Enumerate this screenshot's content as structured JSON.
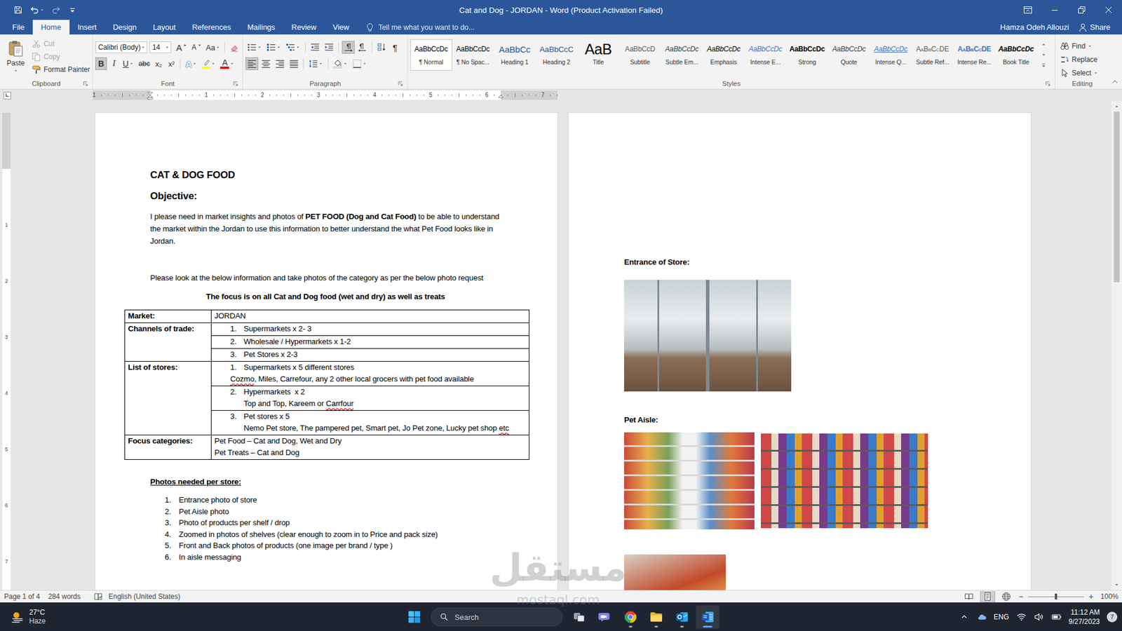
{
  "window": {
    "title": "Cat and Dog - JORDAN - Word (Product Activation Failed)"
  },
  "quick_access": {
    "undo_disabled": false,
    "redo_disabled": true
  },
  "tabs": [
    {
      "label": "File",
      "selected": false
    },
    {
      "label": "Home",
      "selected": true
    },
    {
      "label": "Insert",
      "selected": false
    },
    {
      "label": "Design",
      "selected": false
    },
    {
      "label": "Layout",
      "selected": false
    },
    {
      "label": "References",
      "selected": false
    },
    {
      "label": "Mailings",
      "selected": false
    },
    {
      "label": "Review",
      "selected": false
    },
    {
      "label": "View",
      "selected": false
    }
  ],
  "tell_me": {
    "placeholder": "Tell me what you want to do..."
  },
  "user": {
    "name": "Hamza Odeh Allouzi"
  },
  "share": {
    "label": "Share"
  },
  "ribbon": {
    "clipboard": {
      "label": "Clipboard",
      "paste": "Paste",
      "items": [
        {
          "label": "Cut",
          "disabled": true
        },
        {
          "label": "Copy",
          "disabled": true
        },
        {
          "label": "Format Painter",
          "disabled": false
        }
      ]
    },
    "font": {
      "label": "Font",
      "name": "Calibri (Body)",
      "size": "14",
      "grow": "A",
      "shrink": "A",
      "change_case": "Aa",
      "format": [
        {
          "label": "B",
          "kind": "bold",
          "selected": true
        },
        {
          "label": "I",
          "kind": "italic",
          "selected": false
        },
        {
          "label": "U",
          "kind": "underline",
          "selected": false
        },
        {
          "label": "abc",
          "kind": "strike",
          "selected": false
        },
        {
          "label": "x₂",
          "kind": "sub",
          "selected": false
        },
        {
          "label": "x²",
          "kind": "sup",
          "selected": false
        }
      ],
      "effects": "A",
      "highlight_color": "#ffff00",
      "font_color_label": "A",
      "font_color": "#ff0000"
    },
    "paragraph": {
      "label": "Paragraph",
      "pilcrow": "¶",
      "direction": [
        {
          "selected": true
        },
        {
          "selected": false
        }
      ],
      "alignment": [
        {
          "selected": true
        },
        {
          "selected": false
        },
        {
          "selected": false
        },
        {
          "selected": false
        }
      ]
    },
    "styles": {
      "label": "Styles",
      "items": [
        {
          "preview": "AaBbCcDc",
          "name": "¶ Normal",
          "kind": "normal",
          "selected": true
        },
        {
          "preview": "AaBbCcDc",
          "name": "¶ No Spac...",
          "kind": "normal",
          "selected": false
        },
        {
          "preview": "AaBbCc",
          "name": "Heading 1",
          "kind": "heading1",
          "selected": false
        },
        {
          "preview": "AaBbCcC",
          "name": "Heading 2",
          "kind": "heading2",
          "selected": false
        },
        {
          "preview": "AaB",
          "name": "Title",
          "kind": "title",
          "selected": false
        },
        {
          "preview": "AaBbCcD",
          "name": "Subtitle",
          "kind": "subtitle",
          "selected": false
        },
        {
          "preview": "AaBbCcDc",
          "name": "Subtle Em...",
          "kind": "subtle-emphasis",
          "selected": false
        },
        {
          "preview": "AaBbCcDc",
          "name": "Emphasis",
          "kind": "emphasis",
          "selected": false
        },
        {
          "preview": "AaBbCcDc",
          "name": "Intense E...",
          "kind": "intense-emphasis",
          "selected": false
        },
        {
          "preview": "AaBbCcDc",
          "name": "Strong",
          "kind": "strong",
          "selected": false
        },
        {
          "preview": "AaBbCcDc",
          "name": "Quote",
          "kind": "quote",
          "selected": false
        },
        {
          "preview": "AaBbCcDc",
          "name": "Intense Q...",
          "kind": "intense-quote",
          "selected": false
        },
        {
          "preview": "AaBbCcDE",
          "name": "Subtle Ref...",
          "kind": "subtle-reference",
          "selected": false
        },
        {
          "preview": "AaBbCcDE",
          "name": "Intense Re...",
          "kind": "intense-reference",
          "selected": false
        },
        {
          "preview": "AaBbCcDc",
          "name": "Book Title",
          "kind": "book-title",
          "selected": false
        }
      ]
    },
    "editing": {
      "label": "Editing",
      "items": [
        {
          "label": "Find",
          "has_menu": true
        },
        {
          "label": "Replace",
          "has_menu": false
        },
        {
          "label": "Select",
          "has_menu": true
        }
      ]
    }
  },
  "ruler": {
    "labels": [
      "1",
      "1",
      "2",
      "3",
      "4",
      "5",
      "6",
      "7"
    ],
    "vertical_labels": [
      "1",
      "2",
      "3",
      "4",
      "5",
      "6",
      "7"
    ]
  },
  "document": {
    "page1": {
      "title": "CAT & DOG FOOD",
      "objective_heading": "Objective:",
      "objective": [
        {
          "text": "I please need in market insights and photos of ",
          "bold": false
        },
        {
          "text": "PET FOOD (Dog and Cat Food)",
          "bold": true
        },
        {
          "text": " to be able to understand the market within the Jordan to use this information to better understand the what Pet Food looks like in Jordan.",
          "bold": false
        }
      ],
      "instruction": "Please look at the below information and take photos of the category as per the below photo request",
      "focus_note": "The focus is on all Cat and Dog food (wet and dry) as well as treats",
      "table": [
        {
          "label": "Market:",
          "cells": [
            {
              "lines": [
                {
                  "kind": "plain",
                  "num": "",
                  "runs": [
                    {
                      "text": "JORDAN",
                      "misspelled": false
                    }
                  ]
                }
              ]
            }
          ]
        },
        {
          "label": "Channels of trade:",
          "cells": [
            {
              "lines": [
                {
                  "kind": "numbered",
                  "num": "1.",
                  "runs": [
                    {
                      "text": "Supermarkets x 2- 3",
                      "misspelled": false
                    }
                  ]
                }
              ]
            },
            {
              "lines": [
                {
                  "kind": "numbered",
                  "num": "2.",
                  "runs": [
                    {
                      "text": "Wholesale / Hypermarkets x 1-2",
                      "misspelled": false
                    }
                  ]
                }
              ]
            },
            {
              "lines": [
                {
                  "kind": "numbered",
                  "num": "3.",
                  "runs": [
                    {
                      "text": "Pet Stores x 2-3",
                      "misspelled": false
                    }
                  ]
                }
              ]
            }
          ]
        },
        {
          "label": "List of stores:",
          "cells": [
            {
              "lines": [
                {
                  "kind": "numbered",
                  "num": "1.",
                  "runs": [
                    {
                      "text": "Supermarkets x 5 different stores",
                      "misspelled": false
                    }
                  ]
                },
                {
                  "kind": "flush",
                  "num": "",
                  "runs": [
                    {
                      "text": "Cozmo",
                      "misspelled": true
                    },
                    {
                      "text": ", Miles, Carrefour, any 2 other local grocers with pet food available",
                      "misspelled": false
                    }
                  ]
                }
              ]
            },
            {
              "lines": [
                {
                  "kind": "numbered",
                  "num": "2.",
                  "runs": [
                    {
                      "text": "Hypermarkets  x 2",
                      "misspelled": false
                    }
                  ]
                },
                {
                  "kind": "indented",
                  "num": "",
                  "runs": [
                    {
                      "text": "Top and Top, Kareem or ",
                      "misspelled": false
                    },
                    {
                      "text": "Carrfour",
                      "misspelled": true
                    }
                  ]
                }
              ]
            },
            {
              "lines": [
                {
                  "kind": "numbered",
                  "num": "3.",
                  "runs": [
                    {
                      "text": "Pet stores x 5",
                      "misspelled": false
                    }
                  ]
                },
                {
                  "kind": "indented",
                  "num": "",
                  "runs": [
                    {
                      "text": "Nemo Pet store, The pampered pet, Smart pet, Jo Pet zone, Lucky pet shop ",
                      "misspelled": false
                    },
                    {
                      "text": "etc",
                      "misspelled": true
                    }
                  ]
                }
              ]
            }
          ]
        },
        {
          "label": "Focus categories:",
          "cells": [
            {
              "lines": [
                {
                  "kind": "plain",
                  "num": "",
                  "runs": [
                    {
                      "text": "Pet Food – Cat and Dog, Wet and Dry",
                      "misspelled": false
                    }
                  ]
                },
                {
                  "kind": "plain",
                  "num": "",
                  "runs": [
                    {
                      "text": "Pet Treats – Cat and Dog",
                      "misspelled": false
                    }
                  ]
                }
              ]
            }
          ]
        }
      ],
      "photos_heading": "Photos needed per store:",
      "photos_list": [
        {
          "num": "1.",
          "text": "Entrance photo of store"
        },
        {
          "num": "2.",
          "text": "Pet Aisle photo"
        },
        {
          "num": "3.",
          "text": "Photo of products per shelf / drop"
        },
        {
          "num": "4.",
          "text": "Zoomed in photos of shelves (clear enough to zoom in to Price and pack size)"
        },
        {
          "num": "5.",
          "text": "Front and Back photos of products (one image per brand / type )"
        },
        {
          "num": "6.",
          "text": "In aisle messaging"
        }
      ]
    },
    "page2": {
      "sections": [
        {
          "heading": "Entrance of Store:",
          "photos": [
            {
              "kind": "entrance"
            }
          ]
        },
        {
          "heading": "Pet Aisle:",
          "photos": [
            {
              "kind": "aisle"
            },
            {
              "kind": "shelf"
            },
            {
              "kind": "produce"
            }
          ]
        }
      ]
    }
  },
  "status_bar": {
    "page": "Page 1 of 4",
    "words": "284 words",
    "language": "English (United States)",
    "views": [
      {
        "selected": false
      },
      {
        "selected": true
      },
      {
        "selected": false
      }
    ],
    "zoom": {
      "minus": "−",
      "plus": "+",
      "level": 0.5,
      "reading": "100%"
    }
  },
  "taskbar": {
    "weather": {
      "temp": "27°C",
      "condition": "Haze"
    },
    "search": {
      "placeholder": "Search"
    },
    "apps": [
      {
        "active": false,
        "running": false
      },
      {
        "active": false,
        "running": false
      },
      {
        "active": false,
        "running": true
      },
      {
        "active": false,
        "running": true
      },
      {
        "active": false,
        "running": true
      },
      {
        "active": true,
        "running": true
      }
    ],
    "language": "ENG",
    "time": "11:12 AM",
    "date": "9/27/2023",
    "notifications": "7"
  },
  "watermark": {
    "arabic": "مستقل",
    "latin": "mostaql.com"
  }
}
